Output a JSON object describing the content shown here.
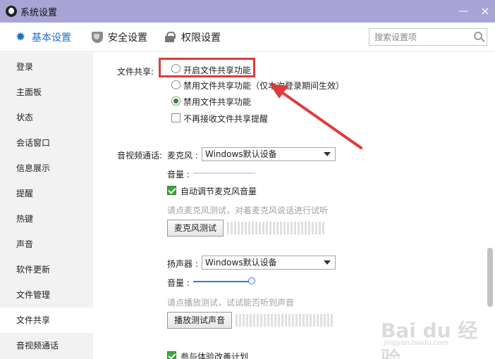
{
  "window": {
    "title": "系统设置",
    "minimize": "—",
    "close": "×"
  },
  "toolbar": {
    "tabs": [
      {
        "label": "基本设置"
      },
      {
        "label": "安全设置"
      },
      {
        "label": "权限设置"
      }
    ],
    "search_placeholder": "搜索设置项"
  },
  "sidebar": {
    "items": [
      {
        "label": "登录"
      },
      {
        "label": "主面板"
      },
      {
        "label": "状态"
      },
      {
        "label": "会话窗口"
      },
      {
        "label": "信息展示"
      },
      {
        "label": "提醒"
      },
      {
        "label": "热键"
      },
      {
        "label": "声音"
      },
      {
        "label": "软件更新"
      },
      {
        "label": "文件管理"
      },
      {
        "label": "文件共享"
      },
      {
        "label": "音视频通话"
      }
    ],
    "active_index": 10
  },
  "file_share": {
    "section_label": "文件共享:",
    "options": [
      {
        "label": "开启文件共享功能",
        "checked": false
      },
      {
        "label": "禁用文件共享功能（仅本次登录期间生效）",
        "checked": false
      },
      {
        "label": "禁用文件共享功能",
        "checked": true
      }
    ],
    "no_reminder": {
      "label": "不再接收文件共享提醒",
      "checked": false
    }
  },
  "av_call": {
    "section_label": "音视频通话:",
    "mic": {
      "label": "麦克风 :",
      "device": "Windows默认设备",
      "volume_label": "音量 :",
      "volume_level": 0.0,
      "auto_adjust": {
        "label": "自动调节麦克风音量",
        "checked": true
      },
      "test_hint": "请点麦克风测试，对着麦克风说话进行试听",
      "test_button": "麦克风测试"
    },
    "speaker": {
      "label": "扬声器 :",
      "device": "Windows默认设备",
      "volume_label": "音量 :",
      "volume_level": 1.0,
      "test_hint": "请点播放测试，试试能否听到声音",
      "test_button": "播放测试声音"
    },
    "experience_plan": {
      "label": "参与体验改善计划",
      "checked": true
    }
  },
  "watermark": {
    "logo_text": "Bai du 经验",
    "site": "jingyan.baidu.com"
  },
  "colors": {
    "titlebar": "#a8a4d6",
    "accent": "#1d6fc9",
    "highlight": "#e03a3a",
    "check": "#3aa83a"
  }
}
